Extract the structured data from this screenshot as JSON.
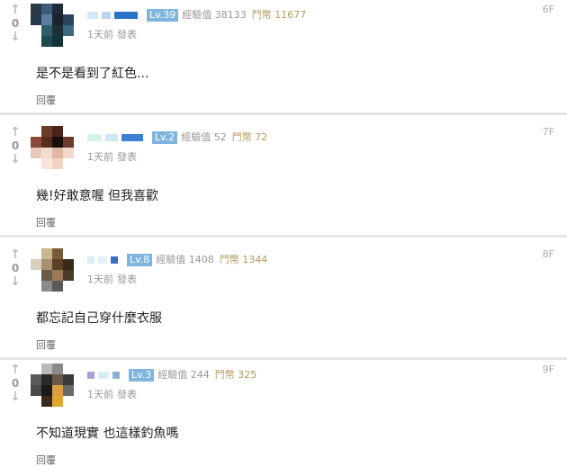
{
  "posts": [
    {
      "floor": "6F",
      "score": "0",
      "level": "Lv.39",
      "exp": "經驗值 38133",
      "coin": "鬥幣 11677",
      "time": "1天前",
      "publish": "發表",
      "content": "是不是看到了紅色...",
      "reply": "回覆"
    },
    {
      "floor": "7F",
      "score": "0",
      "level": "Lv.2",
      "exp": "經驗值 52",
      "coin": "鬥幣 72",
      "time": "1天前",
      "publish": "發表",
      "content": "幾!好敢意喔 但我喜歡",
      "reply": "回覆"
    },
    {
      "floor": "8F",
      "score": "0",
      "level": "Lv.8",
      "exp": "經驗值 1408",
      "coin": "鬥幣 1344",
      "time": "1天前",
      "publish": "發表",
      "content": "都忘記自己穿什麼衣服",
      "reply": "回覆"
    },
    {
      "floor": "9F",
      "score": "0",
      "level": "Lv.3",
      "exp": "經驗值 244",
      "coin": "鬥幣 325",
      "time": "1天前",
      "publish": "發表",
      "content": "不知道現實 也這樣釣魚嗎",
      "reply": "回覆"
    }
  ],
  "vote_icons": {
    "up": "arrow-up-icon",
    "down": "arrow-down-icon"
  },
  "colors": {
    "level_badge": "#7fb5de",
    "coin_text": "#b09a5c",
    "muted_text": "#999999",
    "divider": "#e6e6e6"
  }
}
